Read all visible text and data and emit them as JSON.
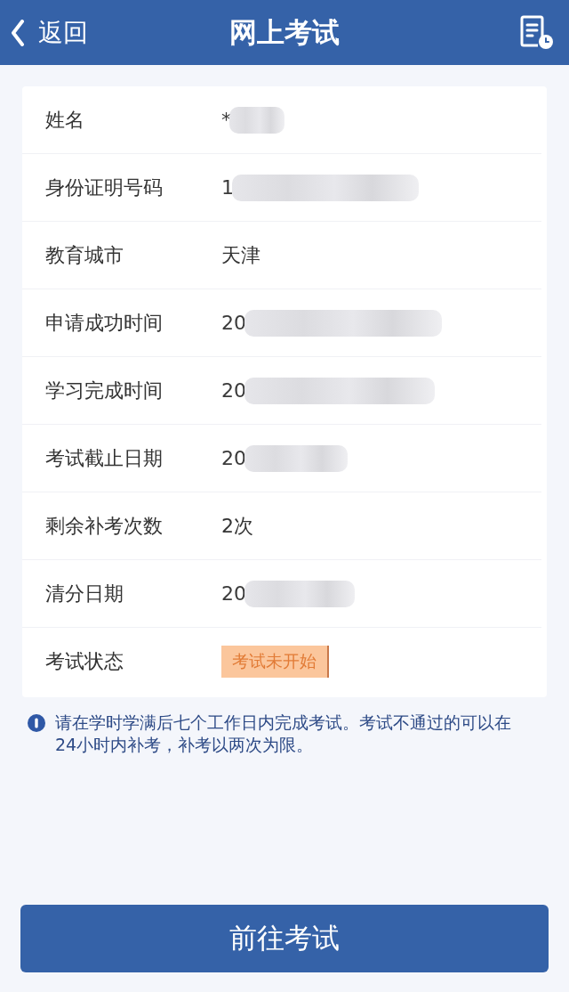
{
  "header": {
    "back_label": "返回",
    "title": "网上考试"
  },
  "fields": [
    {
      "label": "姓名",
      "value": "*",
      "kind": "text",
      "redacted": true
    },
    {
      "label": "身份证明号码",
      "value": "1",
      "kind": "text",
      "redacted": true
    },
    {
      "label": "教育城市",
      "value": "天津",
      "kind": "text",
      "redacted": false
    },
    {
      "label": "申请成功时间",
      "value": "20",
      "kind": "text",
      "redacted": true
    },
    {
      "label": "学习完成时间",
      "value": "20",
      "kind": "text",
      "redacted": true
    },
    {
      "label": "考试截止日期",
      "value": "20",
      "kind": "text",
      "redacted": true
    },
    {
      "label": "剩余补考次数",
      "value": "2次",
      "kind": "text",
      "redacted": false
    },
    {
      "label": "清分日期",
      "value": "20",
      "kind": "text",
      "redacted": true
    },
    {
      "label": "考试状态",
      "value": "考试未开始",
      "kind": "badge",
      "redacted": false
    }
  ],
  "notice": "请在学时学满后七个工作日内完成考试。考试不通过的可以在24小时内补考，补考以两次为限。",
  "button": "前往考试"
}
